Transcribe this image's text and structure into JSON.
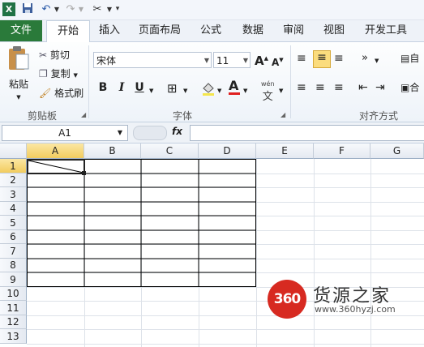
{
  "quick_access": {
    "icons": [
      "excel-logo-icon",
      "save-icon",
      "undo-icon",
      "dropdown-arrow-icon",
      "redo-icon",
      "dropdown-arrow-icon",
      "customize-icon",
      "dropdown-arrow-icon"
    ]
  },
  "tabs": {
    "file": "文件",
    "items": [
      "开始",
      "插入",
      "页面布局",
      "公式",
      "数据",
      "审阅",
      "视图",
      "开发工具"
    ],
    "active": "开始"
  },
  "ribbon": {
    "clipboard": {
      "paste": "粘贴",
      "cut": "剪切",
      "copy": "复制",
      "format_painter": "格式刷",
      "label": "剪贴板"
    },
    "font": {
      "name": "宋体",
      "size": "11",
      "grow": "A",
      "shrink": "A",
      "bold": "B",
      "italic": "I",
      "underline": "U",
      "label": "字体",
      "wen": "wén"
    },
    "alignment": {
      "label": "对齐方式",
      "wrap": "自",
      "merge": "合"
    }
  },
  "formula_bar": {
    "name_box": "A1",
    "fx": "fx",
    "value": ""
  },
  "sheet": {
    "columns": [
      "A",
      "B",
      "C",
      "D",
      "E",
      "F",
      "G"
    ],
    "rows": [
      "1",
      "2",
      "3",
      "4",
      "5",
      "6",
      "7",
      "8",
      "9",
      "10",
      "11",
      "12",
      "13"
    ],
    "selected_cell": "A1"
  },
  "watermark": {
    "logo": "360",
    "name": "货源之家",
    "url": "www.360hyzj.com"
  },
  "colors": {
    "file_tab": "#2a7a3a",
    "selection": "#f2cc5e",
    "watermark_red": "#d72a21"
  }
}
